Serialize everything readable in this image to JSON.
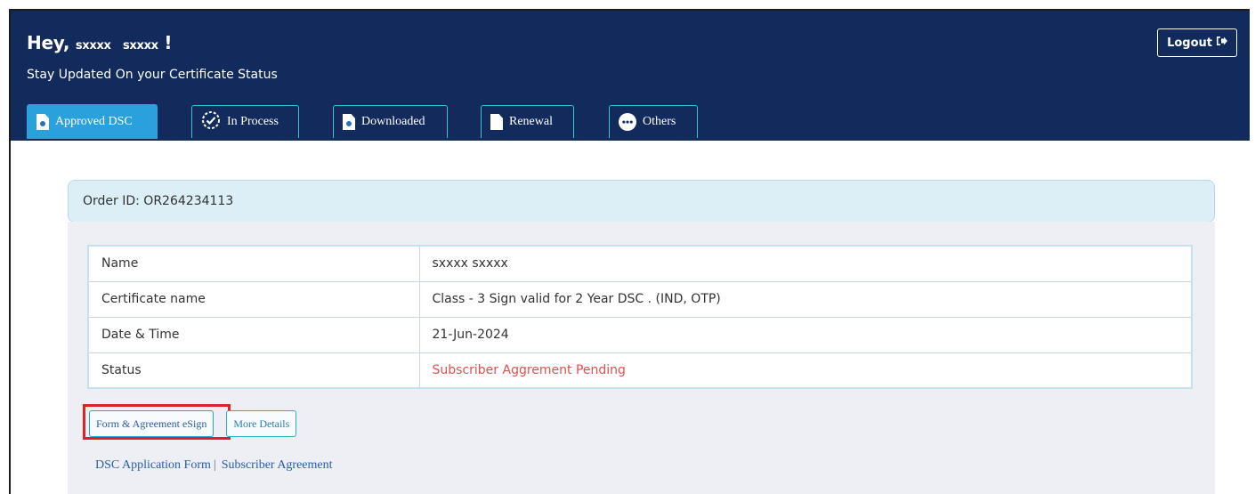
{
  "header": {
    "greeting_prefix": "Hey,",
    "first_name": "sxxxx",
    "last_name": "sxxxx",
    "greeting_suffix": "!",
    "subtitle": "Stay Updated On your Certificate Status",
    "logout_label": "Logout"
  },
  "tabs": [
    {
      "label": "Approved DSC",
      "active": true
    },
    {
      "label": "In Process",
      "active": false
    },
    {
      "label": "Downloaded",
      "active": false
    },
    {
      "label": "Renewal",
      "active": false
    },
    {
      "label": "Others",
      "active": false
    }
  ],
  "order": {
    "order_id_label": "Order ID: OR264234113",
    "rows": [
      {
        "label": "Name",
        "value": "sxxxx sxxxx"
      },
      {
        "label": "Certificate name",
        "value": "Class - 3 Sign valid for 2 Year DSC . (IND, OTP)"
      },
      {
        "label": "Date & Time",
        "value": "21-Jun-2024"
      },
      {
        "label": "Status",
        "value": "Subscriber Aggrement Pending"
      }
    ],
    "esign_button": "Form & Agreement eSign",
    "more_details_button": "More Details",
    "link_application_form": "DSC Application Form",
    "link_separator": "|",
    "link_subscriber_agreement": "Subscriber Agreement"
  },
  "colors": {
    "header_bg": "#132b5c",
    "active_tab": "#2aa0dc",
    "tab_border": "#31c5d6",
    "status_red": "#d9534f",
    "highlight_red": "#e02028"
  }
}
